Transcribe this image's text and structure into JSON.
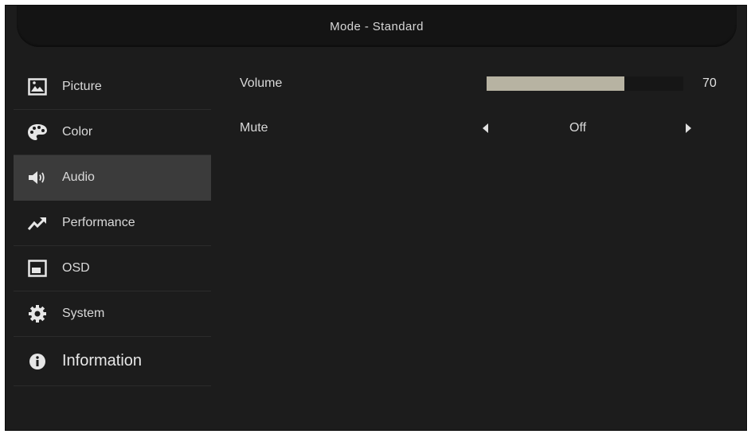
{
  "header": {
    "title": "Mode - Standard"
  },
  "sidebar": {
    "items": [
      {
        "label": "Picture",
        "icon": "picture-icon",
        "active": false
      },
      {
        "label": "Color",
        "icon": "palette-icon",
        "active": false
      },
      {
        "label": "Audio",
        "icon": "speaker-icon",
        "active": true
      },
      {
        "label": "Performance",
        "icon": "trend-up-icon",
        "active": false
      },
      {
        "label": "OSD",
        "icon": "osd-window-icon",
        "active": false
      },
      {
        "label": "System",
        "icon": "gear-icon",
        "active": false
      },
      {
        "label": "Information",
        "icon": "info-icon",
        "active": false
      }
    ]
  },
  "audio": {
    "volume": {
      "label": "Volume",
      "value": 70,
      "value_text": "70"
    },
    "mute": {
      "label": "Mute",
      "value": "Off"
    }
  },
  "colors": {
    "background": "#1c1c1c",
    "active_item": "#3b3b3b",
    "volume_fill": "#b7b3a2"
  }
}
